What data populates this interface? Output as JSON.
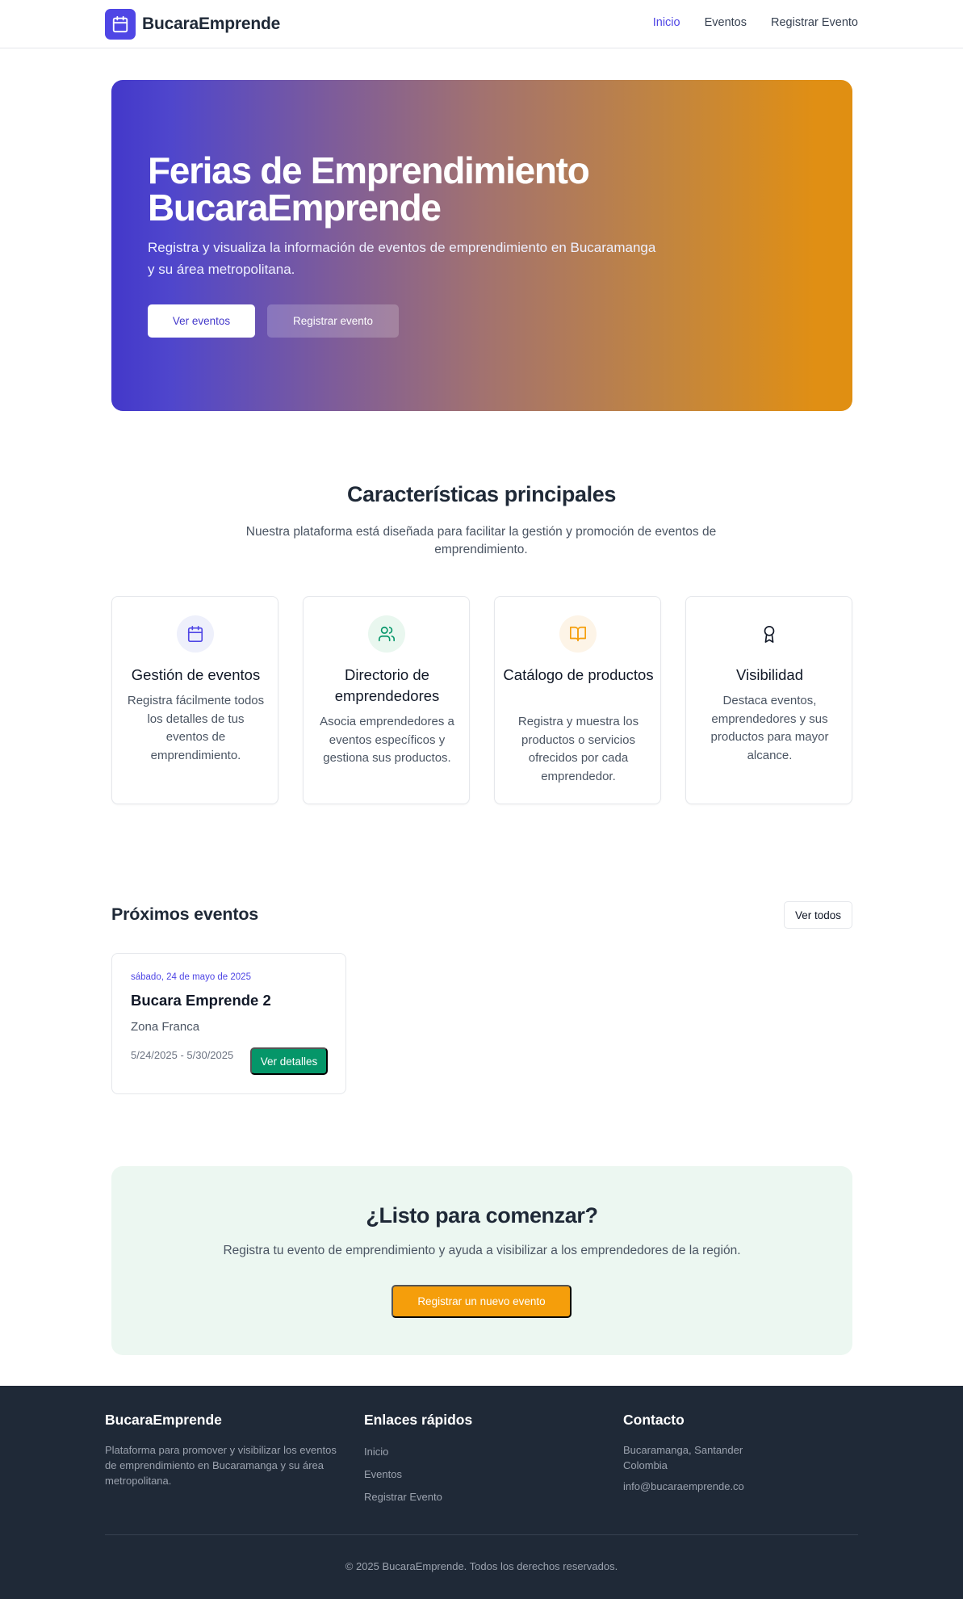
{
  "header": {
    "brand": "BucaraEmprende",
    "nav": [
      "Inicio",
      "Eventos",
      "Registrar Evento"
    ]
  },
  "hero": {
    "title": "Ferias de Emprendimiento BucaraEmprende",
    "subtitle": "Registra y visualiza la información de eventos de emprendimiento en Bucaramanga y su área metropolitana.",
    "primary_button": "Ver eventos",
    "secondary_button": "Registrar evento"
  },
  "features": {
    "title": "Características principales",
    "subtitle": "Nuestra plataforma está diseñada para facilitar la gestión y promoción de eventos de emprendimiento.",
    "items": [
      {
        "icon": "calendar-icon",
        "title": "Gestión de eventos",
        "text": "Registra fácilmente todos los detalles de tus eventos de emprendimiento."
      },
      {
        "icon": "users-icon",
        "title": "Directorio de emprendedores",
        "text": "Asocia emprendedores a eventos específicos y gestiona sus productos."
      },
      {
        "icon": "book-open-icon",
        "title": "Catálogo de productos",
        "text": "Registra y muestra los productos o servicios ofrecidos por cada emprendedor."
      },
      {
        "icon": "award-icon",
        "title": "Visibilidad",
        "text": "Destaca eventos, emprendedores y sus productos para mayor alcance."
      }
    ]
  },
  "events": {
    "title": "Próximos eventos",
    "view_all": "Ver todos",
    "items": [
      {
        "date": "sábado, 24 de mayo de 2025",
        "name": "Bucara Emprende 2",
        "place": "Zona Franca",
        "range": "5/24/2025 - 5/30/2025",
        "button": "Ver detalles"
      }
    ]
  },
  "cta": {
    "title": "¿Listo para comenzar?",
    "text": "Registra tu evento de emprendimiento y ayuda a visibilizar a los emprendedores de la región.",
    "button": "Registrar un nuevo evento"
  },
  "footer": {
    "brand": "BucaraEmprende",
    "description": "Plataforma para promover y visibilizar los eventos de emprendimiento en Bucaramanga y su área metropolitana.",
    "links_title": "Enlaces rápidos",
    "links": [
      "Inicio",
      "Eventos",
      "Registrar Evento"
    ],
    "contact_title": "Contacto",
    "contact_city": "Bucaramanga, Santander",
    "contact_country": "Colombia",
    "contact_email": "info@bucaraemprende.co",
    "copyright": "© 2025 BucaraEmprende. Todos los derechos reservados."
  },
  "colors": {
    "primary": "#4f46e5",
    "accent": "#f59e0b",
    "success": "#059669",
    "footer_bg": "#1f2937"
  }
}
